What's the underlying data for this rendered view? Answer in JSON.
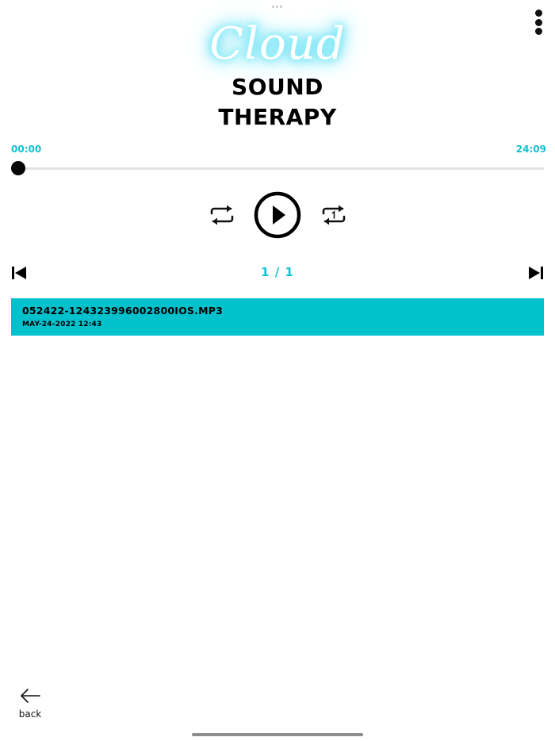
{
  "app": {
    "logo_script": "Cloud",
    "logo_line1": "SOUND",
    "logo_line2": "THERAPY"
  },
  "player": {
    "current_time": "00:00",
    "total_time": "24:09",
    "progress": 0.007,
    "page_counter": "1 / 1"
  },
  "playlist": [
    {
      "title": "052422-124323996002800IOS.MP3",
      "date": "MAY-24-2022 12:43"
    }
  ],
  "nav": {
    "back_label": "back"
  },
  "icons": {
    "menu": "more-vertical-icon",
    "repeat": "repeat-icon",
    "play": "play-circle-icon",
    "repeat_one": "repeat-one-icon",
    "previous": "skip-previous-icon",
    "next": "skip-next-icon",
    "back": "arrow-left-icon"
  },
  "colors": {
    "accent": "#14c1d0",
    "selected_row": "#00c1cc"
  }
}
